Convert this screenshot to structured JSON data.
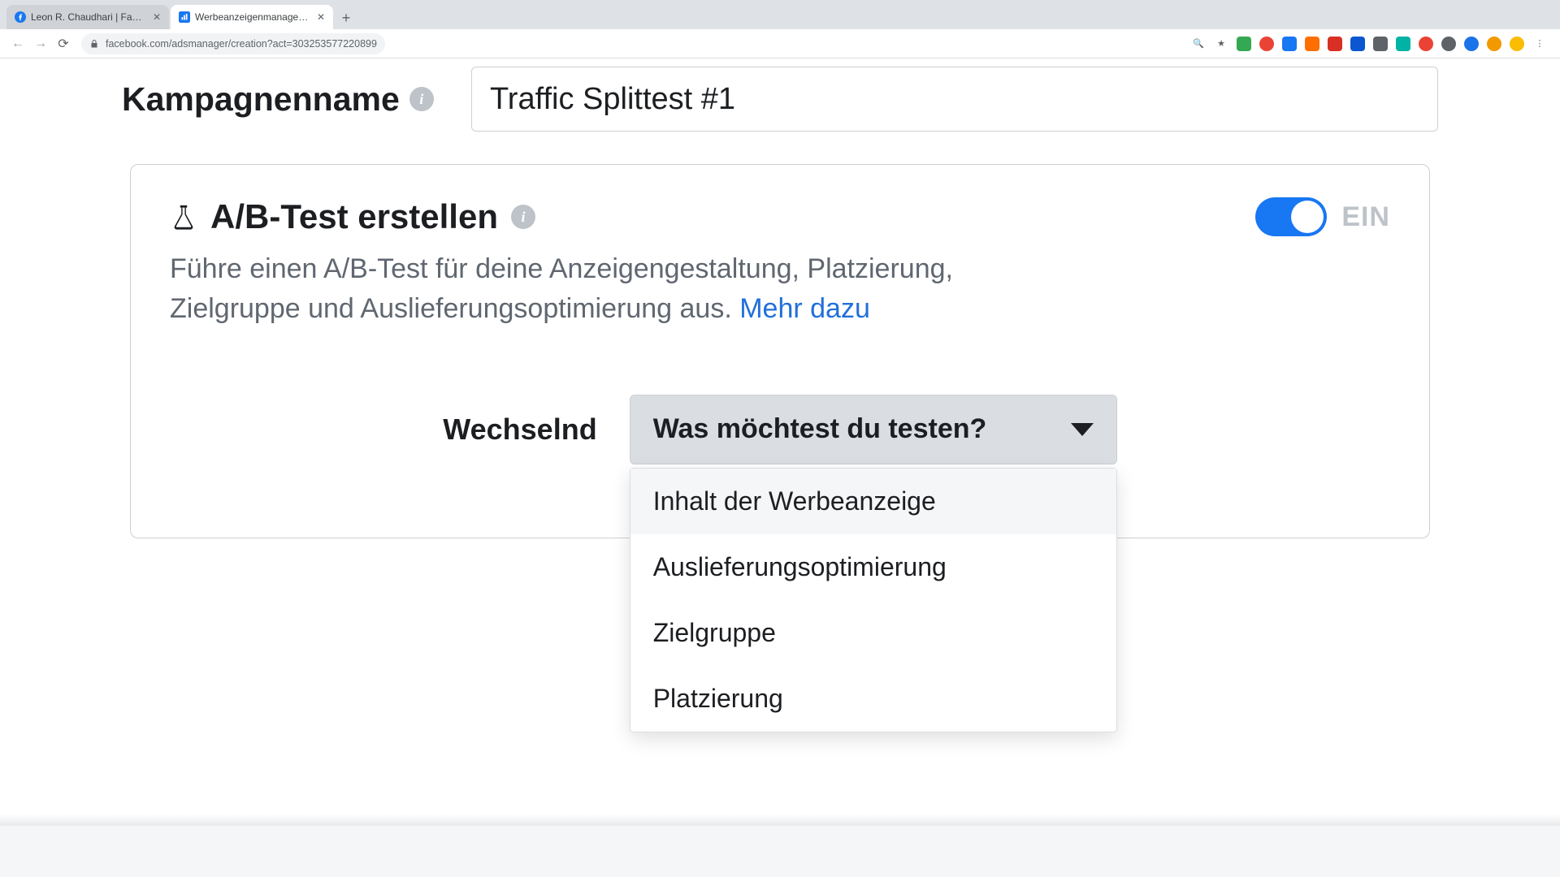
{
  "browser": {
    "tabs": [
      {
        "title": "Leon R. Chaudhari | Facebook",
        "active": false
      },
      {
        "title": "Werbeanzeigenmanager - Cre…",
        "active": true
      }
    ],
    "url": "facebook.com/adsmanager/creation?act=303253577220899"
  },
  "campaign": {
    "label": "Kampagnenname",
    "value": "Traffic Splittest #1"
  },
  "abtest": {
    "title": "A/B-Test erstellen",
    "description": "Führe einen A/B-Test für deine Anzeigengestaltung, Platzierung, Zielgruppe und Auslieferungsoptimierung aus. ",
    "learn_more": "Mehr dazu",
    "toggle_state": "EIN",
    "select_label": "Wechselnd",
    "select_placeholder": "Was möchtest du testen?",
    "options": [
      "Inhalt der Werbeanzeige",
      "Auslieferungsoptimierung",
      "Zielgruppe",
      "Platzierung"
    ]
  },
  "ext_colors": [
    "#9aa0a6",
    "#34a853",
    "#ea4335",
    "#1877f2",
    "#ff6f00",
    "#d93025",
    "#0b57d0",
    "#5f6368",
    "#00b3a4",
    "#ea4335",
    "#5f6368",
    "#1a73e8",
    "#f29900",
    "#fbbc04",
    "#34a853"
  ]
}
